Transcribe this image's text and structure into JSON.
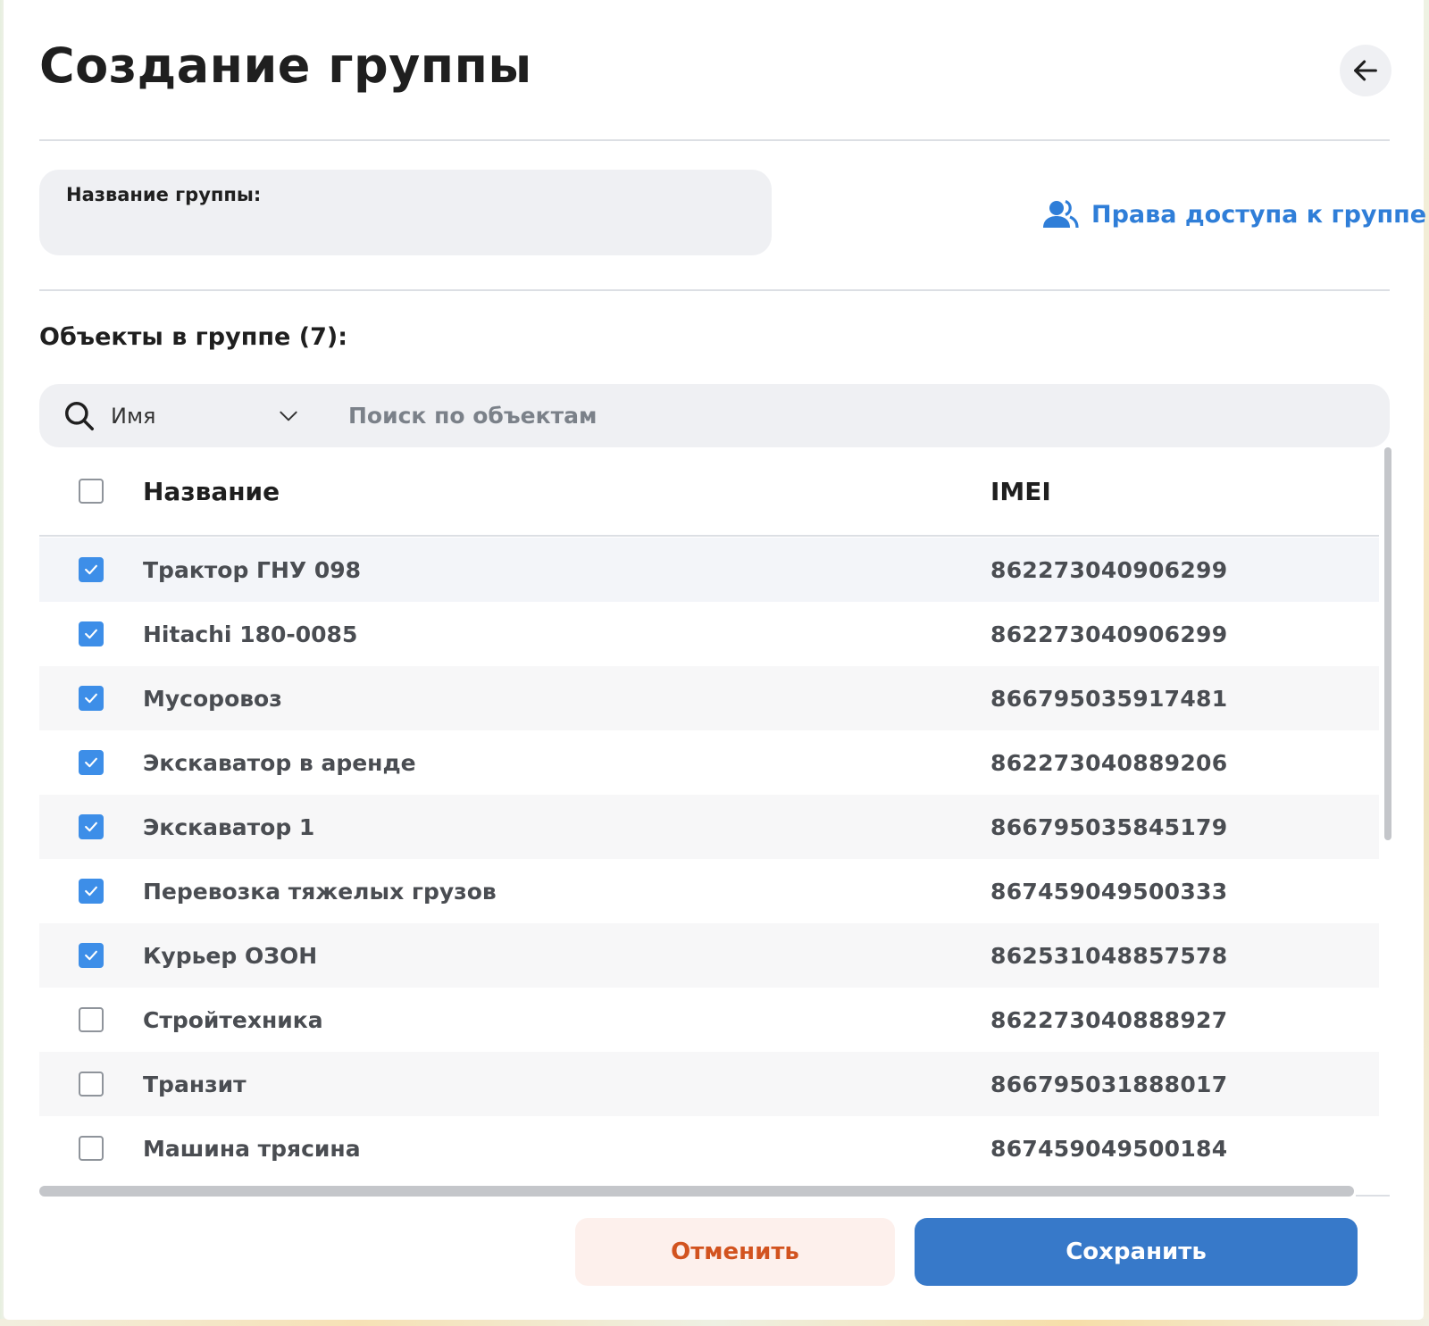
{
  "header": {
    "title": "Создание группы"
  },
  "form": {
    "group_name_label": "Название группы:",
    "group_name_value": "",
    "access_link_label": "Права доступа к группе"
  },
  "objects": {
    "section_label": "Объекты в группе (7):",
    "search": {
      "filter_value": "Имя",
      "placeholder": "Поиск по объектам"
    },
    "columns": {
      "name": "Название",
      "imei": "IMEI"
    },
    "rows": [
      {
        "name": "Трактор ГНУ 098",
        "imei": "862273040906299",
        "checked": true
      },
      {
        "name": "Hitachi 180-0085",
        "imei": "862273040906299",
        "checked": true
      },
      {
        "name": "Мусоровоз",
        "imei": "866795035917481",
        "checked": true
      },
      {
        "name": "Экскаватор в аренде",
        "imei": "862273040889206",
        "checked": true
      },
      {
        "name": "Экскаватор 1",
        "imei": "866795035845179",
        "checked": true
      },
      {
        "name": "Перевозка тяжелых грузов",
        "imei": "867459049500333",
        "checked": true
      },
      {
        "name": "Курьер ОЗОН",
        "imei": "862531048857578",
        "checked": true
      },
      {
        "name": "Стройтехника",
        "imei": "862273040888927",
        "checked": false
      },
      {
        "name": "Транзит",
        "imei": "866795031888017",
        "checked": false
      },
      {
        "name": "Машина трясина",
        "imei": "867459049500184",
        "checked": false
      }
    ]
  },
  "footer": {
    "cancel_label": "Отменить",
    "save_label": "Сохранить"
  },
  "colors": {
    "accent": "#3779c9",
    "link": "#2f7ed8",
    "checkbox": "#3d8ee8",
    "cancel_text": "#d2531f",
    "cancel_bg": "#fdf0ec"
  }
}
